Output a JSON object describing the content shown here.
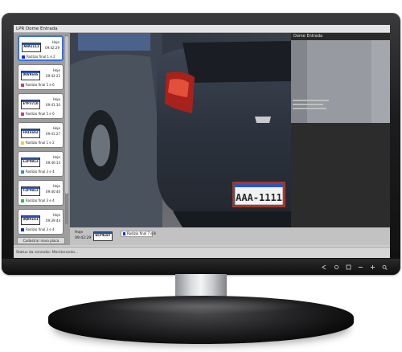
{
  "app_title": "LPR Dome Entrada",
  "preview_title": "Dome Entrada",
  "register_button": "Cadastrar nova placa",
  "status_text": "Status da conexão: Monitorando...",
  "colors": {
    "selected_border": "#3d6fd8",
    "plate_red": "#d23a2a"
  },
  "events": [
    {
      "plate": "AAA1111",
      "day": "Hoje",
      "time": "09:42:29",
      "area": "Rodízio final 1 e 2",
      "swatch": "#1c2fd6",
      "selected": true
    },
    {
      "plate": "DOV9585",
      "day": "Hoje",
      "time": "09:42:22",
      "area": "Rodízio final 5 e 6",
      "swatch": "#d6318e",
      "selected": false
    },
    {
      "plate": "EYP3716",
      "day": "Hoje",
      "time": "09:41:30",
      "area": "Rodízio final 5 e 6",
      "swatch": "#d6318e",
      "selected": false
    },
    {
      "plate": "FHI5562",
      "day": "Hoje",
      "time": "09:41:27",
      "area": "Rodízio final 1 e 2",
      "swatch": "#e8d52a",
      "selected": false
    },
    {
      "plate": "LZP4013",
      "day": "Hoje",
      "time": "09:40:14",
      "area": "Rodízio final 3 e 4",
      "swatch": "#2a8ee8",
      "selected": false
    },
    {
      "plate": "FZP4013",
      "day": "Hoje",
      "time": "09:40:46",
      "area": "Rodízio final 3 e 4",
      "swatch": "#2ec23a",
      "selected": false
    },
    {
      "plate": "DQR4161",
      "day": "Hoje",
      "time": "09:39:44",
      "area": "Rodízio final 3 e 4",
      "swatch": "#1c2fd6",
      "selected": false
    }
  ],
  "video": {
    "plate_text": "AAA-1111"
  },
  "bottom_event": {
    "day": "Hoje",
    "time": "09:42:29",
    "plate": "GCP4187",
    "area": "Rodízio final 7 e 8"
  },
  "taskbar_icons": [
    "back-icon",
    "record-icon",
    "save-icon",
    "minimize-icon",
    "zoom-in-icon",
    "zoom-out-icon"
  ]
}
